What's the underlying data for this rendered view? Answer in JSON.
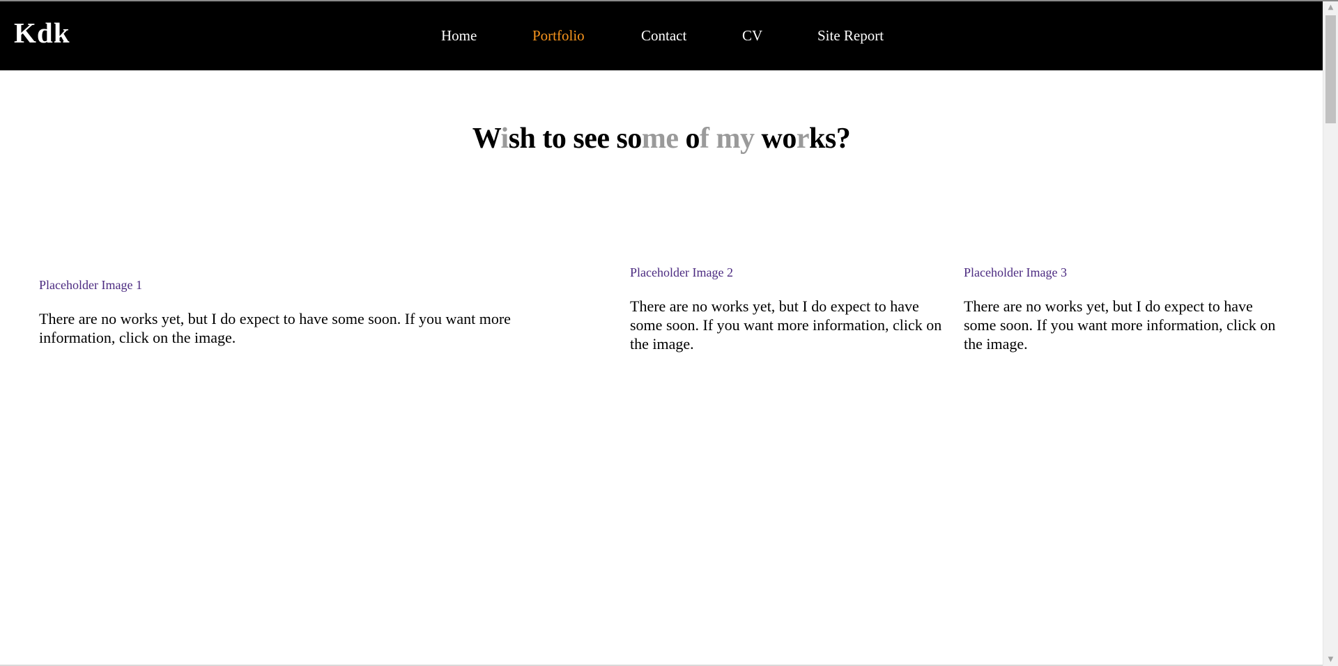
{
  "nav": {
    "brand": "Kdk",
    "links": [
      "Home",
      "Portfolio",
      "Contact",
      "CV",
      "Site Report"
    ],
    "active": "Portfolio"
  },
  "main": {
    "heading_parts": [
      "W",
      "i",
      "sh to see so",
      "me",
      " o",
      "f",
      " ",
      "my",
      " wo",
      "r",
      "ks?"
    ]
  },
  "cards": [
    {
      "image_label": "Placeholder Image 1",
      "description": "There are no works yet, but I do expect to have some soon. If you want more information, click on the image."
    },
    {
      "image_label": "Placeholder Image 2",
      "description": "There are no works yet, but I do expect to have some soon. If you want more information, click on the image."
    },
    {
      "image_label": "Placeholder Image 3",
      "description": "There are no works yet, but I do expect to have some soon. If you want more information, click on the image."
    }
  ],
  "colors": {
    "nav_background": "#000000",
    "nav_text": "#ffffff",
    "nav_active": "#f7941d",
    "image_link": "#4b2a80"
  }
}
